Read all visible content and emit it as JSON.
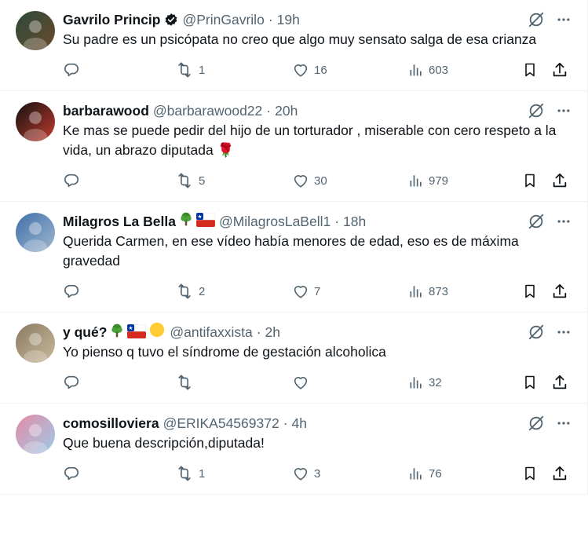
{
  "tweets": [
    {
      "name": "Gavrilo Princip",
      "verified": true,
      "flags": [],
      "handle": "@PrinGavrilo",
      "time": "19h",
      "text": "Su padre es un psicópata no creo que algo muy sensato salga de esa crianza",
      "replies": "",
      "retweets": "1",
      "likes": "16",
      "views": "603",
      "avatar_colors": [
        "#2b4a3a",
        "#6b4a2c"
      ]
    },
    {
      "name": "barbarawood",
      "verified": false,
      "flags": [],
      "handle": "@barbarawood22",
      "time": "20h",
      "text": "Ke mas se puede pedir del hijo de un torturador , miserable con cero respeto a la vida, un abrazo diputada 🌹",
      "replies": "",
      "retweets": "5",
      "likes": "30",
      "views": "979",
      "avatar_colors": [
        "#111111",
        "#c23b2e"
      ]
    },
    {
      "name": "Milagros La Bella",
      "verified": false,
      "flags": [
        "tree",
        "chile"
      ],
      "handle": "@MilagrosLaBell1",
      "time": "18h",
      "text": "Querida Carmen, en ese vídeo había menores de edad, eso es de máxima gravedad",
      "replies": "",
      "retweets": "2",
      "likes": "7",
      "views": "873",
      "avatar_colors": [
        "#3f6fa8",
        "#9fb6cf"
      ]
    },
    {
      "name": "y qué?",
      "verified": false,
      "flags": [
        "tree",
        "chile",
        "sun"
      ],
      "handle": "@antifaxxista",
      "time": "2h",
      "text": "Yo pienso q tuvo el síndrome de gestación alcoholica",
      "replies": "",
      "retweets": "",
      "likes": "",
      "views": "32",
      "avatar_colors": [
        "#8a7a63",
        "#c9b99a"
      ]
    },
    {
      "name": "comosilloviera",
      "verified": false,
      "flags": [],
      "handle": "@ERIKA54569372",
      "time": "4h",
      "text": "Que buena descripción,diputada!",
      "replies": "",
      "retweets": "1",
      "likes": "3",
      "views": "76",
      "avatar_colors": [
        "#e58aa6",
        "#9ccbe8"
      ]
    }
  ],
  "icons": {
    "grok": "grok-icon",
    "more": "more-icon",
    "reply": "reply-icon",
    "retweet": "retweet-icon",
    "like": "heart-icon",
    "views": "views-icon",
    "bookmark": "bookmark-icon",
    "share": "share-icon"
  },
  "colors": {
    "text": "#0f1419",
    "secondary": "#536471",
    "border": "#eff3f4"
  }
}
